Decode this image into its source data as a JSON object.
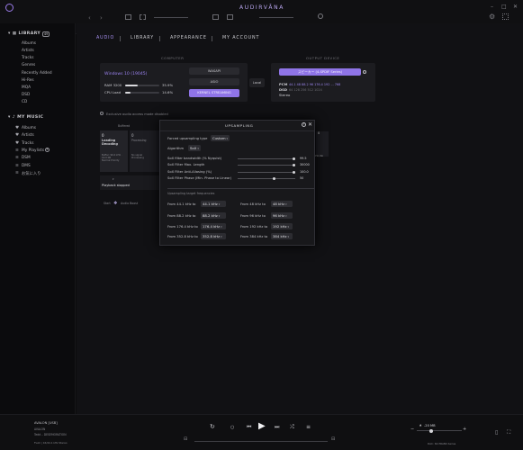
{
  "app": {
    "title": "AUDIRVĀNA",
    "window_controls": [
      "–",
      "□",
      "✕"
    ]
  },
  "toolbar": {
    "back": "‹",
    "forward": "›",
    "icons": [
      "grid-view-icon",
      "list-view-icon",
      "columns-view-icon",
      "search-icon",
      "settings-icon",
      "remote-icon"
    ]
  },
  "sidebar": {
    "library": {
      "label": "LIBRARY",
      "count": "49"
    },
    "library_items": [
      "Albums",
      "Artists",
      "Tracks",
      "Genres",
      "Recently Added",
      "Hi-Res",
      "MQA",
      "DSD",
      "CD"
    ],
    "my_music": {
      "label": "MY MUSIC"
    },
    "my_music_items": [
      {
        "icon": "heart-icon",
        "label": "Albums"
      },
      {
        "icon": "heart-icon",
        "label": "Artists"
      },
      {
        "icon": "heart-icon",
        "label": "Tracks"
      },
      {
        "icon": "playlist-icon",
        "label": "My Playlists"
      },
      {
        "icon": "playlist-icon",
        "label": "DSM"
      },
      {
        "icon": "playlist-icon",
        "label": "DMS"
      },
      {
        "icon": "playlist-icon",
        "label": "お気に入り"
      }
    ]
  },
  "tabs": [
    "AUDIO",
    "LIBRARY",
    "APPEARANCE",
    "MY ACCOUNT"
  ],
  "computer": {
    "section_label": "COMPUTER",
    "os": "Windows 10 (19045)",
    "ram_label": "RAM 3200",
    "ram_pct": "35.9%",
    "ram_fraction": 0.359,
    "cpu_label": "CPU Load",
    "cpu_pct": "14.6%",
    "cpu_fraction": 0.146,
    "modes": [
      "WASAPI",
      "ASIO",
      "KERNEL STREAMING"
    ],
    "active_mode": "KERNEL STREAMING",
    "local_label": "Local"
  },
  "output": {
    "section_label": "OUTPUT DEVICE",
    "device": "スピーカー (4-SPDIF Series)",
    "pcm_label": "PCM",
    "pcm_rates": [
      "44.1",
      "48",
      "88.2",
      "96",
      "176.4",
      "192",
      "...",
      "768"
    ],
    "dsd_label": "DSD",
    "dsd_rates": [
      "64",
      "128",
      "256",
      "512",
      "1024"
    ],
    "channels": "Stereo"
  },
  "exclusive_text": "Exclusive audio access mode disabled",
  "pipeline": {
    "buffered_label": "Buffered",
    "box1_title": "Loading Decoding",
    "box1_sub": "Buffer: 96.0 kHz · 16.0 KB\nNormal Priority",
    "box2_title": "Processing",
    "box2_sub": "No signal\nProcessing",
    "status": "Playback stopped",
    "start_label": "Start",
    "start_mode": "Audio Boost"
  },
  "upsampling": {
    "title": "UPSAMPLING",
    "type_label": "Forced upsampling type",
    "type_value": "Custom",
    "algorithm_label": "Algorithm",
    "algorithm_value": "SoX",
    "params": [
      {
        "label": "SoX filter bandwidth (% Nyquist)",
        "value": "99.5",
        "fraction": 0.97
      },
      {
        "label": "SoX Filter Max. Length",
        "value": "30000",
        "fraction": 0.97
      },
      {
        "label": "SoX Filter Anti-Aliasing (%)",
        "value": "100.0",
        "fraction": 0.97
      },
      {
        "label": "SoX Filter Phase (Min. Phase to Linear)",
        "value": "50",
        "fraction": 0.63
      }
    ],
    "targets_label": "Upsampling target frequencies",
    "targets": [
      {
        "from": "From 44.1 kHz to",
        "to": "44.1 kHz"
      },
      {
        "from": "From 48 kHz to",
        "to": "48 kHz"
      },
      {
        "from": "From 88.2 kHz to",
        "to": "88.2 kHz"
      },
      {
        "from": "From 96 kHz to",
        "to": "96 kHz"
      },
      {
        "from": "From 176.4 kHz to",
        "to": "176.4 kHz"
      },
      {
        "from": "From 192 kHz to",
        "to": "192 kHz"
      },
      {
        "from": "From 352.8 kHz to",
        "to": "352.8 kHz"
      },
      {
        "from": "From 384 kHz to",
        "to": "384 kHz"
      }
    ]
  },
  "side_text": "kHz, No",
  "player": {
    "track_album": "AVALON [USB]",
    "track_artist": "AVALON",
    "track_title": "Tedd – DESEMORATION",
    "track_format": "FLAC | 16/44.1 kHz Stereo",
    "volume": "-20 MB",
    "device_line": "DAC: SD-TRANS Series",
    "accent": "#8f74e7"
  }
}
